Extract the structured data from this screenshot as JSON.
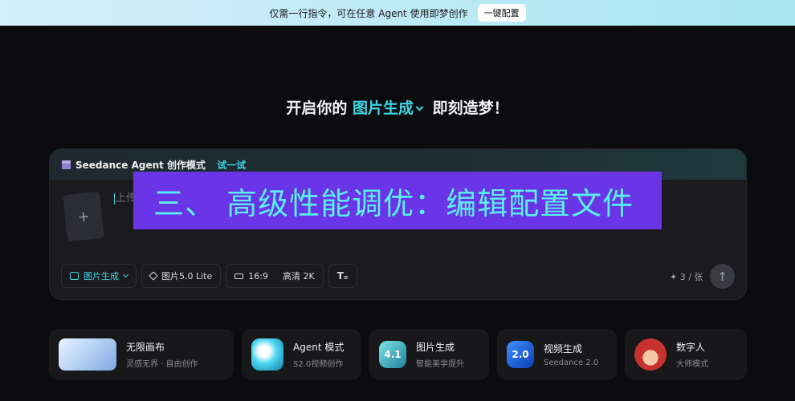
{
  "banner": {
    "text": "仅需一行指令，可在任意 Agent 使用即梦创作",
    "button": "一键配置"
  },
  "headline": {
    "prefix": "开启你的",
    "mode": "图片生成",
    "suffix": "即刻造梦！"
  },
  "card": {
    "title": "Seedance Agent 创作模式",
    "try_link": "试一试",
    "upload_plus": "+",
    "input_placeholder": "上传"
  },
  "overlay": {
    "text": "三、 高级性能调优：编辑配置文件"
  },
  "toolbar": {
    "mode": "图片生成",
    "model": "图片5.0 Lite",
    "ratio": "16:9",
    "quality": "高清 2K",
    "count": "✦ 3 / 张",
    "send_icon": "arrow-up-icon"
  },
  "features": [
    {
      "title": "无限画布",
      "subtitle": "灵感无界 · 自由创作"
    },
    {
      "title": "Agent 模式",
      "subtitle": "S2.0视频创作"
    },
    {
      "title": "图片生成",
      "subtitle": "智能美学提升",
      "badge": "4.1"
    },
    {
      "title": "视频生成",
      "subtitle": "Seedance 2.0",
      "badge": "2.0"
    },
    {
      "title": "数字人",
      "subtitle": "大师模式"
    }
  ],
  "colors": {
    "accent": "#3ed4e2",
    "overlay_bg": "#6a35e6",
    "overlay_text": "#58f0ef",
    "background": "#0c0c0e"
  }
}
